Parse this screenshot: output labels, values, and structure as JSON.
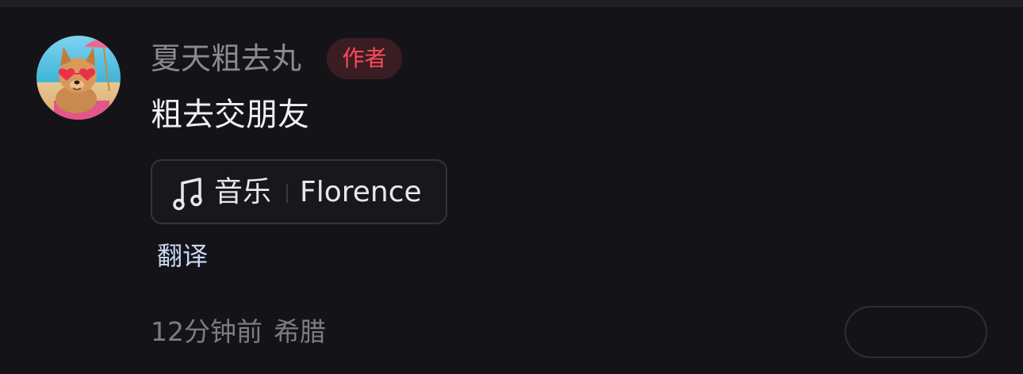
{
  "comment": {
    "username": "夏天粗去丸",
    "author_badge": "作者",
    "text": "粗去交朋友",
    "music": {
      "icon": "music-note-icon",
      "label": "音乐",
      "song": "Florence"
    },
    "translate_label": "翻译",
    "time": "12分钟前",
    "location": "希腊"
  },
  "colors": {
    "background": "#141418",
    "author_badge_text": "#ff4a5a",
    "author_badge_bg": "#3a1d22",
    "translate_link": "#c9d8f4",
    "muted_text": "#7c7c82"
  }
}
